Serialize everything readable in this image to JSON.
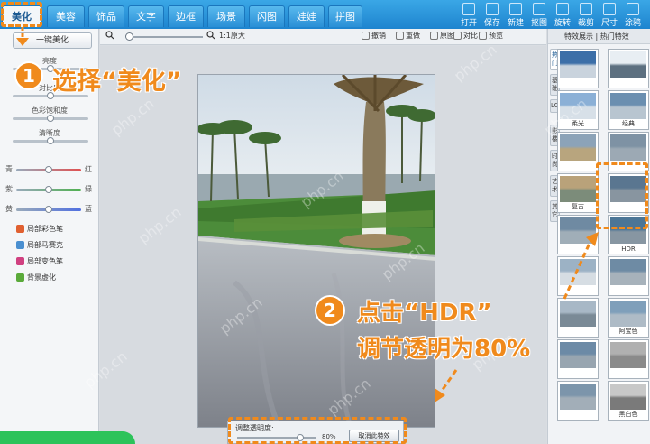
{
  "tabs": [
    {
      "label": "美化",
      "active": true
    },
    {
      "label": "美容"
    },
    {
      "label": "饰品"
    },
    {
      "label": "文字"
    },
    {
      "label": "边框"
    },
    {
      "label": "场景"
    },
    {
      "label": "闪图"
    },
    {
      "label": "娃娃"
    },
    {
      "label": "拼图"
    }
  ],
  "tools": [
    {
      "label": "打开",
      "icon": "folder-icon"
    },
    {
      "label": "保存",
      "icon": "save-icon"
    },
    {
      "label": "新建",
      "icon": "new-icon"
    },
    {
      "label": "抠图",
      "icon": "cutout-icon"
    },
    {
      "label": "旋转",
      "icon": "rotate-icon"
    },
    {
      "label": "裁剪",
      "icon": "crop-icon"
    },
    {
      "label": "尺寸",
      "icon": "resize-icon"
    },
    {
      "label": "涂鸦",
      "icon": "brush-icon"
    }
  ],
  "left": {
    "one_key_label": "一键美化",
    "sliders": [
      {
        "label": "亮度",
        "level": 0.5
      },
      {
        "label": "对比度",
        "level": 0.5
      },
      {
        "label": "色彩饱和度",
        "level": 0.5
      },
      {
        "label": "清晰度",
        "level": 0.5
      }
    ],
    "color_sliders": [
      {
        "left": "青",
        "right": "红",
        "color": "#e05050"
      },
      {
        "left": "紫",
        "right": "绿",
        "color": "#50b050"
      },
      {
        "left": "黄",
        "right": "蓝",
        "color": "#5070e0"
      }
    ],
    "options": [
      {
        "label": "局部彩色笔",
        "color": "#e06030"
      },
      {
        "label": "局部马赛克",
        "color": "#4a8fd0"
      },
      {
        "label": "局部变色笔",
        "color": "#d04080"
      },
      {
        "label": "背景虚化",
        "color": "#5aaa3a"
      }
    ]
  },
  "center_toolbar": {
    "zoom_text": "1:1原大",
    "actions": [
      "撤销",
      "重做",
      "原图",
      "对比",
      "预览"
    ]
  },
  "opacity_panel": {
    "label": "调整透明度:",
    "value": "80%",
    "level": 0.8,
    "confirm": "取消此特效"
  },
  "right": {
    "title": "特效展示 | 热门特效",
    "vtabs": [
      "热门",
      "基础",
      "LOMO",
      "影楼",
      "时尚",
      "艺术",
      "其它"
    ],
    "thumbs": [
      {
        "label": "",
        "c1": "#3c6fa8",
        "c2": "#c9d3dd"
      },
      {
        "label": "",
        "c1": "#e8eef3",
        "c2": "#5d7080"
      },
      {
        "label": "柔光",
        "c1": "#8bb0d6",
        "c2": "#d7e0e8"
      },
      {
        "label": "经典",
        "c1": "#6b8fb0",
        "c2": "#b8c5d0"
      },
      {
        "label": "",
        "c1": "#8ca3b8",
        "c2": "#b8a57e"
      },
      {
        "label": "",
        "c1": "#7e92a4",
        "c2": "#9ca9b4"
      },
      {
        "label": "复古",
        "c1": "#b9a27a",
        "c2": "#7c8c7a"
      },
      {
        "label": "",
        "c1": "#5a7690",
        "c2": "#8895a0"
      },
      {
        "label": "",
        "c1": "#6f8aa2",
        "c2": "#a0aeb8"
      },
      {
        "label": "HDR",
        "c1": "#4b7596",
        "c2": "#8796a2"
      },
      {
        "label": "",
        "c1": "#9cb2c5",
        "c2": "#d6dde3"
      },
      {
        "label": "",
        "c1": "#6e8ba4",
        "c2": "#a7b2bb"
      },
      {
        "label": "",
        "c1": "#a8b8c6",
        "c2": "#7a8a96"
      },
      {
        "label": "阿宝色",
        "c1": "#7f9fba",
        "c2": "#aebbc6"
      },
      {
        "label": "",
        "c1": "#6c8aa6",
        "c2": "#98a5b0"
      },
      {
        "label": "",
        "c1": "#b0b0b0",
        "c2": "#8a8a8a"
      },
      {
        "label": "",
        "c1": "#7c95ab",
        "c2": "#a2aeb8"
      },
      {
        "label": "黑白色",
        "c1": "#c8c8c8",
        "c2": "#7a7a7a"
      }
    ]
  },
  "annotations": {
    "step1_num": "1",
    "step1_text": "选择“美化”",
    "step2_num": "2",
    "step2_line1": "点击“HDR”",
    "step2_line2": "调节透明为80%"
  },
  "watermark": "php.cn",
  "colors": {
    "accent": "#f08a1c",
    "topbar": "#1e84cf"
  }
}
